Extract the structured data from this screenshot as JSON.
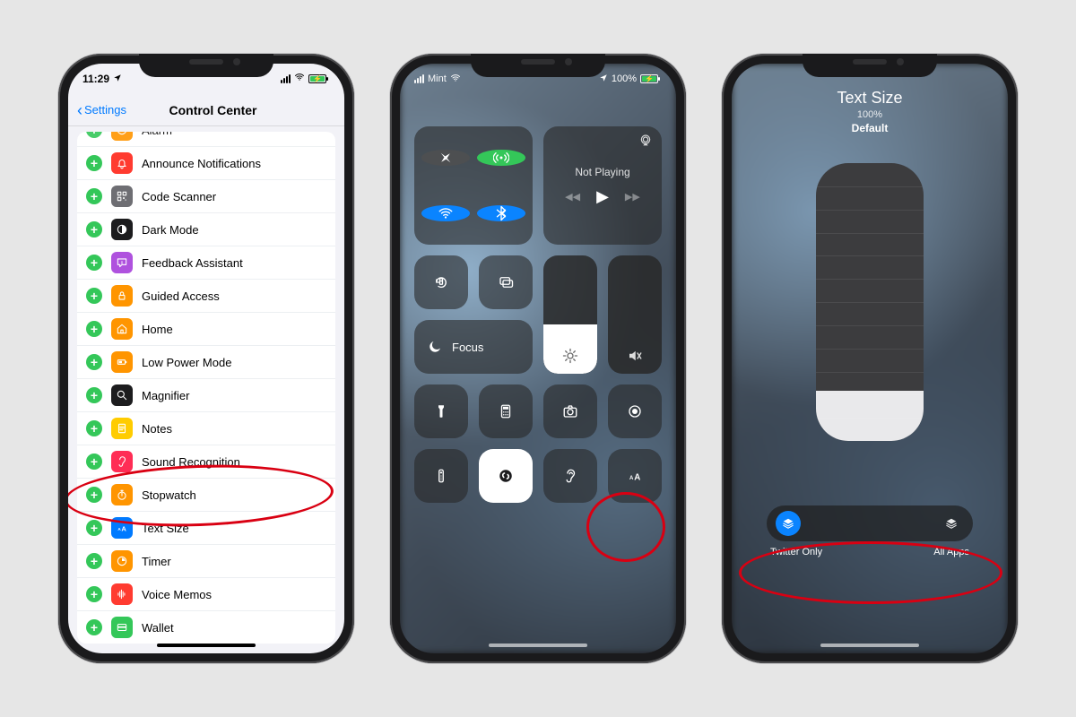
{
  "phone1": {
    "status": {
      "time": "11:29",
      "location_icon": "location-arrow",
      "battery_state": "charging"
    },
    "nav": {
      "back": "Settings",
      "title": "Control Center"
    },
    "rows": [
      {
        "label": "Alarm",
        "color": "#ff9500",
        "icon": "clock"
      },
      {
        "label": "Announce Notifications",
        "color": "#ff3b30",
        "icon": "bell"
      },
      {
        "label": "Code Scanner",
        "color": "#6e6e73",
        "icon": "qr"
      },
      {
        "label": "Dark Mode",
        "color": "#1c1c1e",
        "icon": "darkmode"
      },
      {
        "label": "Feedback Assistant",
        "color": "#af52de",
        "icon": "feedback"
      },
      {
        "label": "Guided Access",
        "color": "#ff9500",
        "icon": "lock"
      },
      {
        "label": "Home",
        "color": "#ff9500",
        "icon": "home"
      },
      {
        "label": "Low Power Mode",
        "color": "#ff9500",
        "icon": "battery"
      },
      {
        "label": "Magnifier",
        "color": "#1c1c1e",
        "icon": "magnifier"
      },
      {
        "label": "Notes",
        "color": "#ffcc00",
        "icon": "notes"
      },
      {
        "label": "Sound Recognition",
        "color": "#ff2d55",
        "icon": "ear"
      },
      {
        "label": "Stopwatch",
        "color": "#ff9500",
        "icon": "stopwatch"
      },
      {
        "label": "Text Size",
        "color": "#007aff",
        "icon": "textsize"
      },
      {
        "label": "Timer",
        "color": "#ff9500",
        "icon": "timer"
      },
      {
        "label": "Voice Memos",
        "color": "#ff3b30",
        "icon": "waveform"
      },
      {
        "label": "Wallet",
        "color": "#34c759",
        "icon": "wallet"
      }
    ]
  },
  "phone2": {
    "status": {
      "carrier": "Mint",
      "battery_pct": "100%",
      "location": true,
      "charging": true
    },
    "music": {
      "label": "Not Playing"
    },
    "focus": {
      "label": "Focus"
    },
    "brightness_pct": 42,
    "volume_pct": 0
  },
  "phone3": {
    "title": "Text Size",
    "percent": "100%",
    "subtitle": "Default",
    "slider_steps": 12,
    "slider_value_pct": 18,
    "toggle": {
      "left": "Twitter Only",
      "right": "All Apps",
      "active": "left"
    }
  },
  "colors": {
    "ios_blue": "#007aff",
    "ios_green": "#34c759",
    "annotation_red": "#d90012"
  }
}
